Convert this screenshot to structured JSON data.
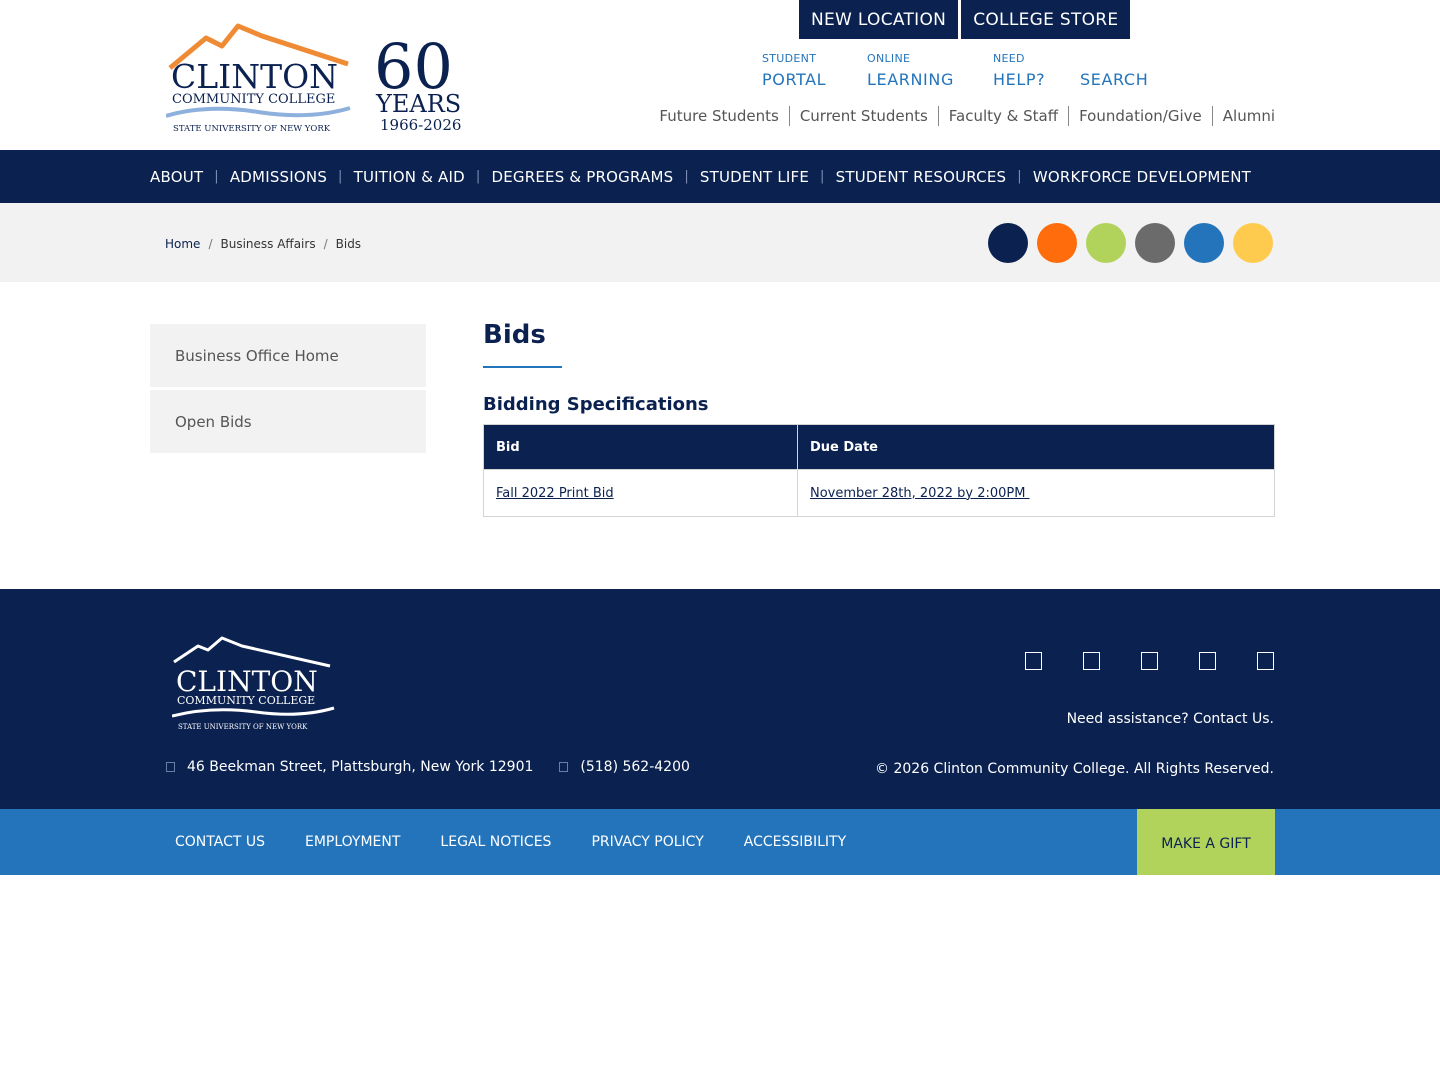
{
  "header": {
    "logo_text": {
      "name": "CLINTON",
      "sub": "COMMUNITY COLLEGE",
      "suny": "STATE UNIVERSITY OF NEW YORK",
      "anniv_num": "60",
      "anniv_word": "YEARS",
      "anniv_dates": "1966-2026"
    },
    "top_buttons": [
      "NEW LOCATION",
      "COLLEGE STORE"
    ],
    "quick_links": [
      {
        "small": "STUDENT",
        "big": "PORTAL"
      },
      {
        "small": "ONLINE",
        "big": "LEARNING"
      },
      {
        "small": "NEED",
        "big": "HELP?"
      },
      {
        "small": "",
        "big": "SEARCH"
      }
    ],
    "audience_links": [
      "Future Students",
      "Current Students",
      "Faculty & Staff",
      "Foundation/Give",
      "Alumni"
    ]
  },
  "nav": {
    "items": [
      "ABOUT",
      "ADMISSIONS",
      "TUITION & AID",
      "DEGREES & PROGRAMS",
      "STUDENT LIFE",
      "STUDENT RESOURCES",
      "WORKFORCE DEVELOPMENT"
    ],
    "separator": "|"
  },
  "breadcrumb": {
    "items": [
      "Home",
      "Business Affairs",
      "Bids"
    ],
    "separator": "/"
  },
  "color_dots": [
    "#0b2150",
    "#ff6c0c",
    "#b2d35b",
    "#6b6b6b",
    "#2474bc",
    "#ffcb4f"
  ],
  "sidebar": {
    "items": [
      "Business Office Home",
      "Open Bids"
    ]
  },
  "content": {
    "title": "Bids",
    "section_title": "Bidding Specifications",
    "table": {
      "headers": [
        "Bid",
        "Due Date"
      ],
      "rows": [
        [
          "Fall 2022 Print Bid",
          "November 28th, 2022 by 2:00PM "
        ]
      ]
    }
  },
  "footer": {
    "logo_name": "CLINTON",
    "logo_sub": "COMMUNITY COLLEGE",
    "logo_suny": "STATE UNIVERSITY OF NEW YORK",
    "social_icons": [
      "facebook-icon",
      "twitter-icon",
      "instagram-icon",
      "youtube-icon",
      "linkedin-icon"
    ],
    "assist": "Need assistance? Contact Us.",
    "address": "46 Beekman Street, Plattsburgh, New York 12901",
    "phone": "(518) 562-4200",
    "copyright": "© 2026 Clinton Community College. All Rights Reserved."
  },
  "bottom_bar": {
    "links": [
      "CONTACT US",
      "EMPLOYMENT",
      "LEGAL NOTICES",
      "PRIVACY POLICY",
      "ACCESSIBILITY"
    ],
    "gift": "MAKE A GIFT"
  },
  "colors": {
    "navy": "#0b2150",
    "blue": "#2474bc",
    "orange": "#ff6c0c",
    "green": "#b2d35b",
    "light_gray": "#f2f2f2"
  }
}
